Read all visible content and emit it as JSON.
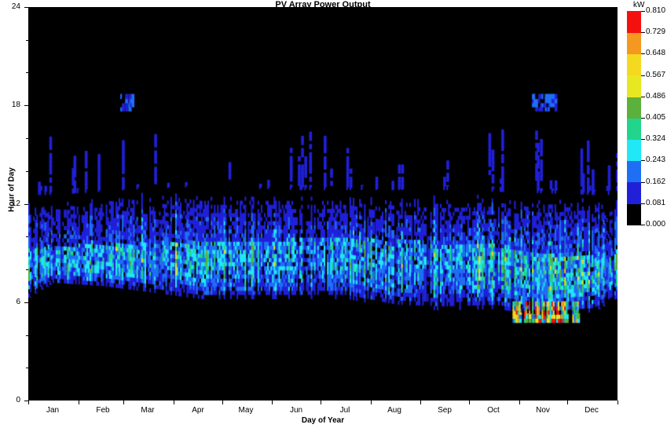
{
  "chart_data": {
    "type": "heatmap",
    "title": "PV Array Power Output",
    "xlabel": "Day of Year",
    "ylabel": "Hour of Day",
    "x": {
      "label": "Day of Year",
      "range": [
        0,
        365
      ],
      "tick_labels": [
        "Jan",
        "Feb",
        "Mar",
        "Apr",
        "May",
        "Jun",
        "Jul",
        "Aug",
        "Sep",
        "Oct",
        "Nov",
        "Dec"
      ],
      "tick_days": [
        15,
        46,
        74,
        105,
        135,
        166,
        196,
        227,
        258,
        288,
        319,
        349
      ]
    },
    "y": {
      "label": "Hour of Day",
      "range": [
        0,
        24
      ],
      "tick_labels": [
        "0",
        "6",
        "12",
        "18",
        "24"
      ],
      "tick_values": [
        0,
        6,
        12,
        18,
        24
      ],
      "minor_tick_values": [
        2,
        4,
        8,
        10,
        14,
        16,
        20,
        22
      ]
    },
    "colorbar": {
      "unit_label": "kW",
      "vmin": 0.0,
      "vmax": 0.81,
      "n_bands": 10,
      "tick_labels": [
        "0.000",
        "0.081",
        "0.162",
        "0.243",
        "0.324",
        "0.405",
        "0.486",
        "0.567",
        "0.648",
        "0.729",
        "0.810"
      ],
      "tick_values": [
        0.0,
        0.081,
        0.162,
        0.243,
        0.324,
        0.405,
        0.486,
        0.567,
        0.648,
        0.729,
        0.81
      ],
      "band_colors": [
        "#000000",
        "#2020d8",
        "#1f6ff5",
        "#20e8f5",
        "#21d58c",
        "#5cb03c",
        "#e8e822",
        "#f5d820",
        "#f59820",
        "#f51010"
      ]
    },
    "grid": false,
    "legend_position": "right",
    "series_note": "Hourly PV array power output (kW) for each day of the year rendered as a heatmap.",
    "generation": {
      "sunrise_hour_by_month": [
        7.0,
        6.8,
        6.4,
        6.0,
        6.0,
        6.0,
        6.0,
        5.4,
        5.3,
        5.4,
        5.0,
        5.2
      ],
      "sunset_hour_by_month": [
        12.6,
        12.8,
        13.0,
        13.1,
        13.0,
        12.9,
        12.9,
        12.9,
        12.9,
        12.8,
        12.7,
        12.6
      ],
      "peak_hour_by_month": [
        8.2,
        8.2,
        8.4,
        8.4,
        8.4,
        8.6,
        8.6,
        8.5,
        8.3,
        8.2,
        7.6,
        7.6
      ],
      "peak_power_by_month": [
        0.35,
        0.4,
        0.42,
        0.4,
        0.36,
        0.33,
        0.33,
        0.36,
        0.38,
        0.42,
        0.52,
        0.4
      ],
      "anomaly_bands": [
        {
          "day_start": 57,
          "day_end": 65,
          "hour_start": 17.7,
          "hour_end": 18.5,
          "note": "late-evening cluster (Feb/Mar)"
        },
        {
          "day_start": 312,
          "day_end": 326,
          "hour_start": 17.7,
          "hour_end": 18.5,
          "note": "late-evening cluster (Nov)"
        },
        {
          "day_start": 300,
          "day_end": 340,
          "hour_start": 4.8,
          "hour_end": 6.0,
          "note": "early-morning high-output cluster (Nov)"
        }
      ],
      "sparse_spike_hour_range": [
        12.2,
        16.5
      ],
      "seed": 20240117
    }
  },
  "axis_style": {
    "plot_background": "#000000",
    "figure_background": "#ffffff",
    "axis_color": "#000000"
  }
}
